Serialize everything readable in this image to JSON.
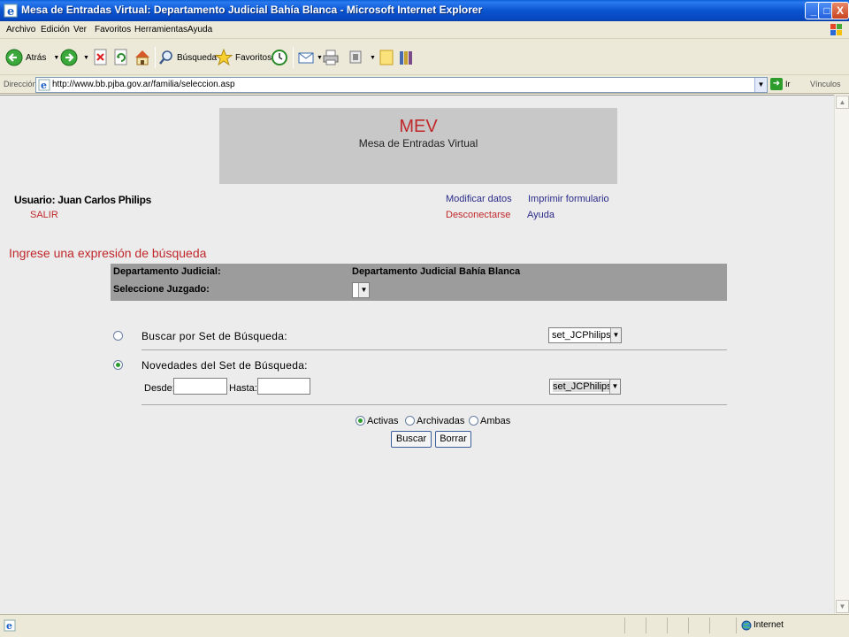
{
  "window": {
    "title": "Mesa de Entradas Virtual: Departamento Judicial Bahía Blanca - Microsoft Internet Explorer",
    "minimize": "_",
    "maximize": "□",
    "close": "X"
  },
  "menu": [
    "Archivo",
    "Edición",
    "Ver",
    "Favoritos",
    "Herramientas",
    "Ayuda"
  ],
  "toolbar": {
    "back_label": "Atrás",
    "search_label": "Búsqueda",
    "favorites_label": "Favoritos"
  },
  "address": {
    "label": "Dirección",
    "url": "http://www.bb.pjba.gov.ar/familia/seleccion.asp",
    "go_label": "Ir",
    "links_label": "Vínculos"
  },
  "header": {
    "title": "MEV",
    "subtitle": "Mesa de Entradas Virtual"
  },
  "user": {
    "usuario": "Usuario: Juan Carlos Philips",
    "salir": "SALIR",
    "modificar": "Modificar datos",
    "imprimir": "Imprimir formulario",
    "desconectar": "Desconectarse",
    "ayuda": "Ayuda"
  },
  "search": {
    "heading": "Ingrese una expresión de búsqueda",
    "departamento_label": "Departamento Judicial:",
    "departamento_value": "Departamento Judicial Bahía Blanca",
    "juzgado_label": "Seleccione Juzgado:",
    "option_set_label": "Buscar por Set de Búsqueda:",
    "option_set_selected": false,
    "option_set_value": "set_JCPhilips",
    "option_novedades_label": "Novedades del Set de Búsqueda:",
    "option_novedades_selected": true,
    "novedades_set_value": "set_JCPhilips",
    "desde_label": "Desde:",
    "desde_value": "",
    "hasta_label": "Hasta:",
    "hasta_value": "",
    "estado_options": [
      "Activas",
      "Archivadas",
      "Ambas"
    ],
    "estado_selected": "Activas",
    "buscar_button": "Buscar",
    "borrar_button": "Borrar"
  },
  "status": {
    "zone": "Internet"
  }
}
